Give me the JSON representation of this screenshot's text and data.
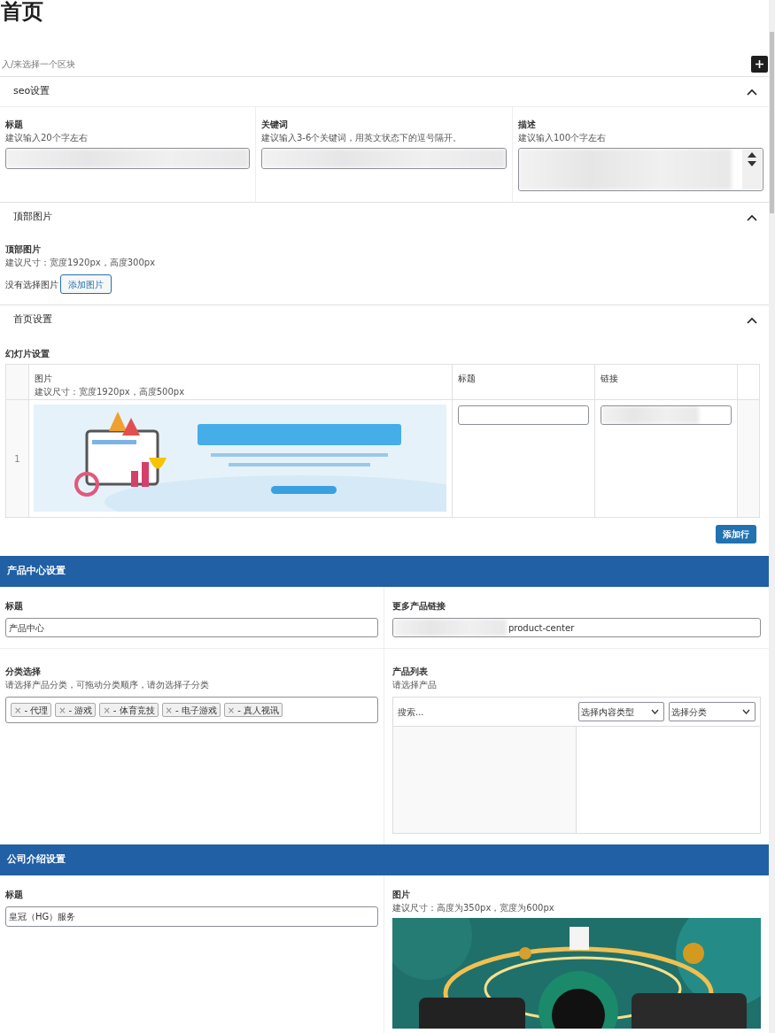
{
  "page_title": "首页",
  "block_prompt": "入/来选择一个区块",
  "panels": [
    {
      "title": "seo设置",
      "expanded": true,
      "kind": "seo",
      "fields": [
        {
          "label": "标题",
          "hint": "建议输入20个字左右",
          "kind": "input"
        },
        {
          "label": "关键词",
          "hint": "建议输入3-6个关键词，用英文状态下的逗号隔开。",
          "kind": "input"
        },
        {
          "label": "描述",
          "hint": "建议输入100个字左右",
          "kind": "textarea"
        }
      ]
    },
    {
      "title": "顶部图片",
      "expanded": true,
      "label": "顶部图片",
      "hint": "建议尺寸：宽度1920px，高度300px",
      "empty_text": "没有选择图片",
      "button": "添加图片"
    },
    {
      "title": "首页设置",
      "expanded": true,
      "kind": "slides",
      "label": "幻灯片设置",
      "columns": [
        {
          "label": "图片",
          "hint": "建议尺寸：宽度1920px，高度500px"
        },
        {
          "label": "标题"
        },
        {
          "label": "链接"
        }
      ],
      "rows": [
        {
          "index": "1"
        }
      ],
      "add_button": "添加行"
    }
  ],
  "product_section": {
    "title": "产品中心设置",
    "title_field": {
      "label": "标题",
      "value": "产品中心"
    },
    "link_field": {
      "label": "更多产品链接",
      "value": "product-center"
    },
    "category": {
      "label": "分类选择",
      "hint": "请选择产品分类，可拖动分类顺序，请勿选择子分类",
      "tags": [
        {
          "remove": "×",
          "label": "- 代理"
        },
        {
          "remove": "×",
          "label": "- 游戏"
        },
        {
          "remove": "×",
          "label": "- 体育竞技"
        },
        {
          "remove": "×",
          "label": "- 电子游戏"
        },
        {
          "remove": "×",
          "label": "- 真人视讯"
        }
      ]
    },
    "products": {
      "label": "产品列表",
      "hint": "请选择产品",
      "search_placeholder": "搜索...",
      "selects": [
        "选择内容类型",
        "选择分类"
      ]
    }
  },
  "company_section": {
    "title": "公司介绍设置",
    "title_field": {
      "label": "标题",
      "value": "皇冠（HG）服务"
    },
    "image": {
      "label": "图片",
      "hint": "建议尺寸：高度为350px，宽度为600px"
    }
  }
}
